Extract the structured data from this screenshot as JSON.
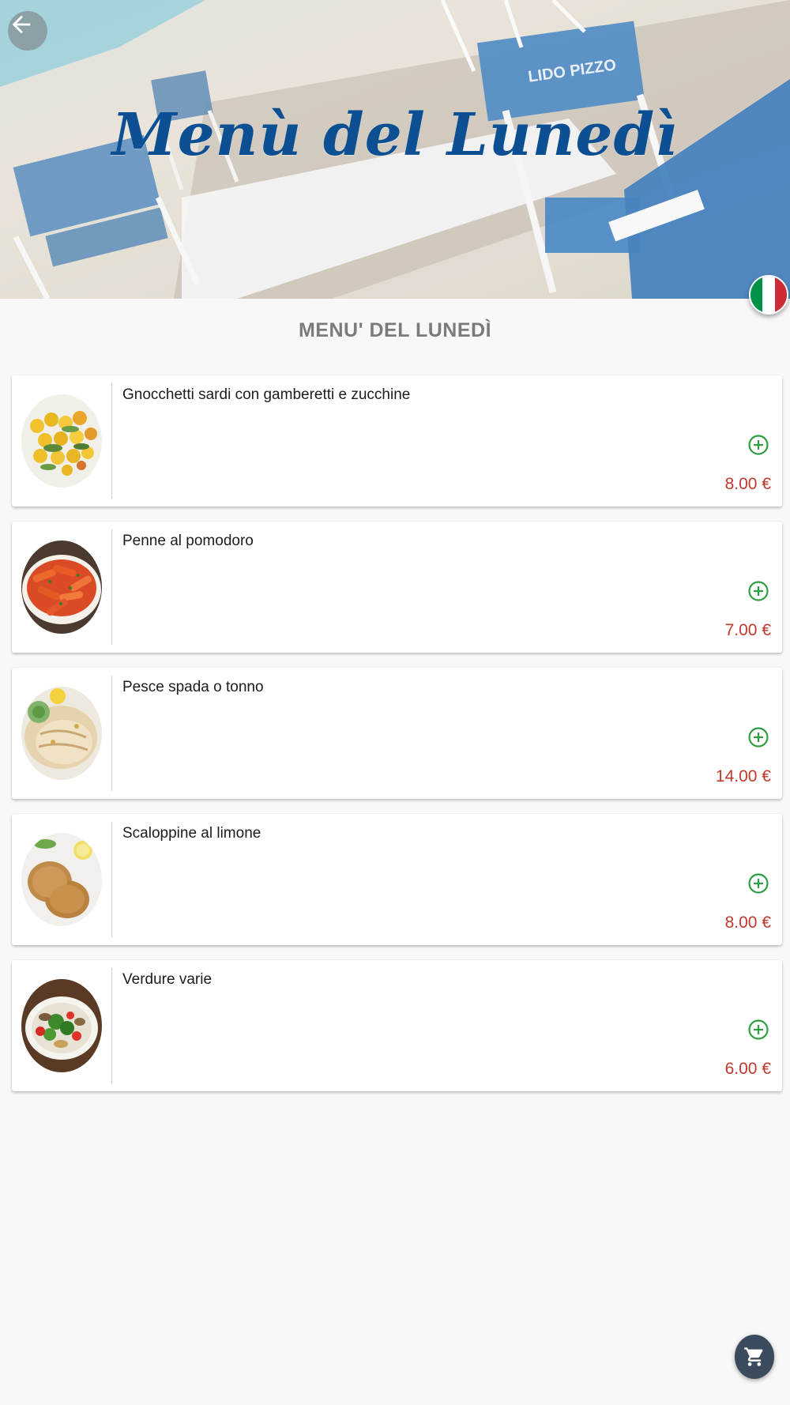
{
  "header": {
    "title": "Menù del Lunedì",
    "chair_text": "LIDO PIZZO",
    "back_icon": "arrow-left-icon",
    "language_flag": "italy-flag-icon"
  },
  "section_title": "MENU' DEL LUNEDÌ",
  "items": [
    {
      "name": "Gnocchetti sardi con gamberetti e zucchine",
      "price": "8.00 €",
      "image": "gnocchetti-dish"
    },
    {
      "name": "Penne al pomodoro",
      "price": "7.00 €",
      "image": "penne-dish"
    },
    {
      "name": "Pesce spada o tonno",
      "price": "14.00 €",
      "image": "fish-dish"
    },
    {
      "name": "Scaloppine al limone",
      "price": "8.00 €",
      "image": "scaloppine-dish"
    },
    {
      "name": "Verdure varie",
      "price": "6.00 €",
      "image": "vegetables-dish"
    }
  ],
  "cart_icon": "cart-icon",
  "colors": {
    "title_blue": "#0d4f93",
    "price_red": "#c0392b",
    "add_green": "#2e9e44",
    "fab_bg": "#3c4a5e"
  }
}
